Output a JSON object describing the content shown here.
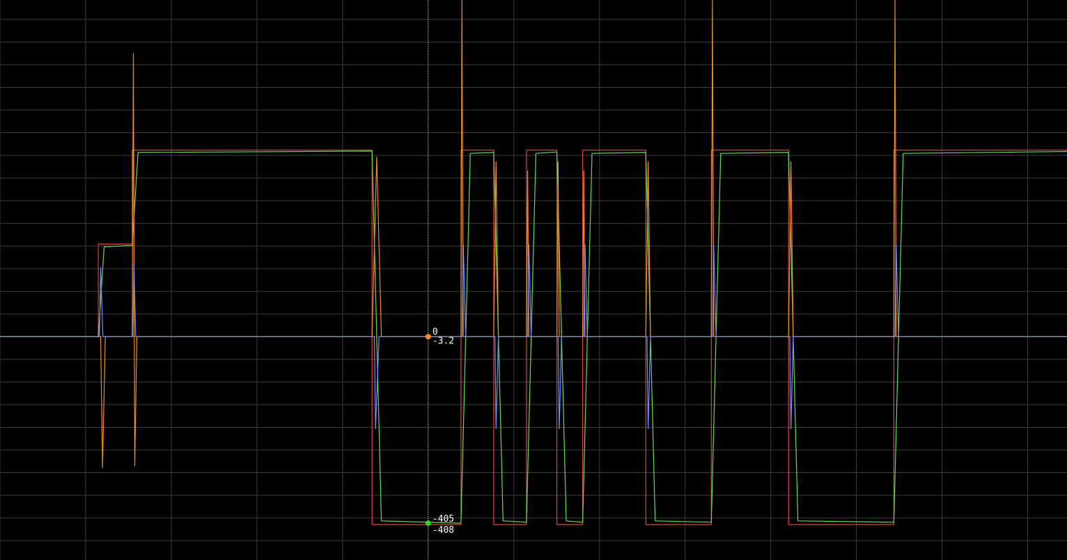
{
  "colors": {
    "background": "#000000",
    "grid": "#3c3c3c",
    "cursor": "#c8c8c8",
    "red": "#e0403a",
    "orange": "#f08c28",
    "green": "#66dd55",
    "blue": "#7a8cff",
    "cyan": "#40d8d0",
    "marker_orange": "#ff8c1a",
    "marker_green": "#22dd22"
  },
  "cursor": {
    "x": 18.3,
    "markers": [
      {
        "series": "orange",
        "y": 0
      },
      {
        "series": "green",
        "y": -405
      }
    ],
    "labels": [
      {
        "text": "0",
        "y": 0,
        "dy": -3
      },
      {
        "text": "-3.2",
        "y": 0,
        "dy": 10
      },
      {
        "text": "-405",
        "y": -405,
        "dy": -2
      },
      {
        "text": "-408",
        "y": -408,
        "dy": 12
      }
    ]
  },
  "chart_data": {
    "type": "line",
    "title": "",
    "xlabel": "",
    "ylabel": "",
    "xlim": [
      0,
      45.6
    ],
    "ylim": [
      -485,
      731
    ],
    "grid": true,
    "x_grid_step": 3.66,
    "y_grid_step": 49.2,
    "series": [
      {
        "color": "red",
        "x": [
          0,
          4.2,
          4.2,
          5.65,
          5.65,
          15.9,
          15.9,
          19.7,
          19.7,
          21.1,
          21.1,
          22.5,
          22.5,
          23.8,
          23.8,
          24.9,
          24.9,
          27.6,
          27.6,
          30.4,
          30.4,
          33.7,
          33.7,
          38.2,
          38.2,
          45.6
        ],
        "y": [
          0,
          0,
          201,
          201,
          405,
          405,
          -408,
          -408,
          405,
          405,
          -408,
          -408,
          405,
          405,
          -408,
          -408,
          405,
          405,
          -408,
          -408,
          405,
          405,
          -408,
          -408,
          405,
          405
        ]
      },
      {
        "color": "green",
        "x": [
          0,
          4.2,
          4.45,
          5.65,
          5.9,
          15.9,
          16.3,
          19.7,
          20.1,
          21.1,
          21.5,
          22.5,
          22.9,
          23.8,
          24.2,
          24.9,
          25.3,
          27.6,
          28.0,
          30.4,
          30.8,
          33.7,
          34.1,
          38.2,
          38.6,
          45.6
        ],
        "y": [
          0,
          0,
          195,
          198,
          400,
          403,
          -400,
          -405,
          398,
          400,
          -400,
          -403,
          398,
          401,
          -400,
          -403,
          398,
          400,
          -400,
          -403,
          398,
          400,
          -400,
          -403,
          398,
          402
        ]
      },
      {
        "color": "orange",
        "x": [
          0,
          4.3,
          4.38,
          4.5,
          5.65,
          5.7,
          5.76,
          5.85,
          15.9,
          16.1,
          16.3,
          19.7,
          19.74,
          19.8,
          21.1,
          21.2,
          21.3,
          22.5,
          22.55,
          22.6,
          23.8,
          23.85,
          23.9,
          24.9,
          24.95,
          25.0,
          27.6,
          27.7,
          27.8,
          30.4,
          30.45,
          30.5,
          33.7,
          33.8,
          33.9,
          38.2,
          38.25,
          38.3,
          45.6
        ],
        "y": [
          0,
          0,
          -285,
          0,
          0,
          615,
          -280,
          0,
          0,
          390,
          0,
          0,
          731,
          0,
          0,
          380,
          0,
          0,
          360,
          0,
          0,
          380,
          0,
          0,
          360,
          0,
          0,
          380,
          0,
          0,
          731,
          0,
          0,
          380,
          0,
          0,
          731,
          0,
          0
        ]
      },
      {
        "color": "blue",
        "x": [
          0,
          4.25,
          4.3,
          4.4,
          5.68,
          5.72,
          5.8,
          16.0,
          16.05,
          16.2,
          19.75,
          19.8,
          19.9,
          21.15,
          21.2,
          21.3,
          22.55,
          22.6,
          22.7,
          23.85,
          23.9,
          24.0,
          24.95,
          25.0,
          25.1,
          27.65,
          27.7,
          27.8,
          30.45,
          30.5,
          30.6,
          33.75,
          33.8,
          33.9,
          38.25,
          38.3,
          38.4,
          45.6
        ],
        "y": [
          0,
          0,
          150,
          0,
          0,
          160,
          0,
          0,
          -200,
          0,
          0,
          200,
          0,
          0,
          -200,
          0,
          0,
          200,
          0,
          0,
          -200,
          0,
          0,
          200,
          0,
          0,
          -200,
          0,
          0,
          200,
          0,
          0,
          -200,
          0,
          0,
          200,
          0,
          0
        ]
      }
    ]
  }
}
